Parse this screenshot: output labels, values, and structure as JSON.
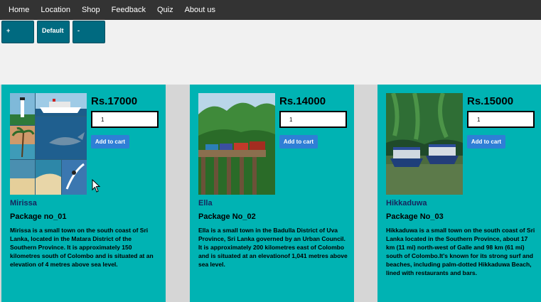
{
  "nav": {
    "items": [
      "Home",
      "Location",
      "Shop",
      "Feedback",
      "Quiz",
      "About us"
    ]
  },
  "zoom": {
    "plus": "+",
    "default": "Default",
    "minus": "-"
  },
  "packages": [
    {
      "price": "Rs.17000",
      "quantity": "1",
      "button": "Add to cart",
      "place": "Mirissa",
      "package": "Package no_01",
      "description": "Mirissa is a small town on the south coast of Sri Lanka, located in the Matara District of the Southern Province. It is approximately 150 kilometres south of Colombo and is situated at an elevation of 4 metres above sea level."
    },
    {
      "price": "Rs.14000",
      "quantity": "1",
      "button": "Add to cart",
      "place": "Ella",
      "package": "Package No_02",
      "description": "Ella is a small town in the Badulla District of Uva Province, Sri Lanka governed by an Urban Council. It is approximately 200 kilometres east of Colombo and is situated at an elevationof 1,041 metres above sea level."
    },
    {
      "price": "Rs.15000",
      "quantity": "1",
      "button": "Add to cart",
      "place": "Hikkaduwa",
      "package": "Package No_03",
      "description": "Hikkaduwa is a small town on the south coast of Sri Lanka located in the Southern Province, about 17 km (11 mi) north-west of Galle and 98 km (61 mi) south of Colombo.It's known for its strong surf and beaches, including palm-dotted Hikkaduwa Beach, lined with restaurants and bars."
    }
  ],
  "colors": {
    "nav": "#333333",
    "card": "#00b3b3",
    "zoom_button": "#006a80",
    "cart_button": "#2f7fd6"
  }
}
